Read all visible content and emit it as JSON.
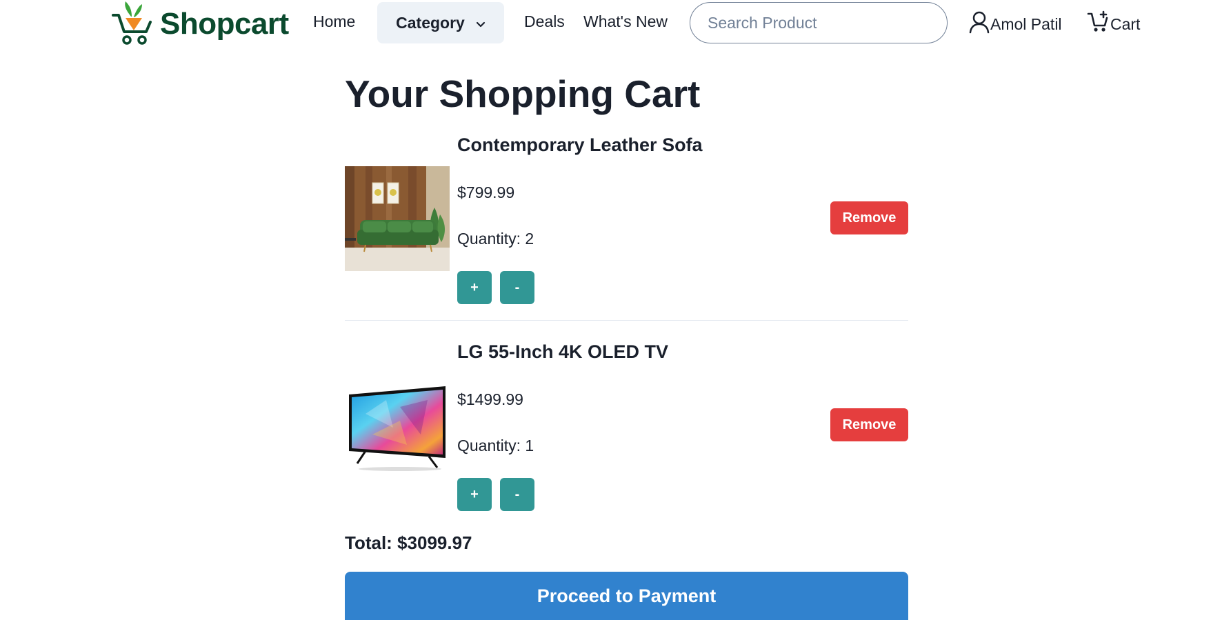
{
  "brand": {
    "name": "Shopcart",
    "color": "#0b4a2e",
    "accent_leaf": "#3aa53a",
    "accent_carrot": "#f08a24"
  },
  "nav": {
    "home": "Home",
    "category": "Category",
    "deals": "Deals",
    "whats_new": "What's New",
    "search_placeholder": "Search Product",
    "user_name": "Amol Patil",
    "cart_label": "Cart"
  },
  "cart": {
    "title": "Your Shopping Cart",
    "items": [
      {
        "name": "Contemporary Leather Sofa",
        "price": "$799.99",
        "quantity_text": "Quantity: 2",
        "plus": "+",
        "minus": "-",
        "remove": "Remove"
      },
      {
        "name": "LG 55-Inch 4K OLED TV",
        "price": "$1499.99",
        "quantity_text": "Quantity: 1",
        "plus": "+",
        "minus": "-",
        "remove": "Remove"
      }
    ],
    "total": "Total: $3099.97",
    "proceed": "Proceed to Payment"
  },
  "colors": {
    "teal": "#319795",
    "red": "#e53e3e",
    "blue": "#3182ce"
  }
}
